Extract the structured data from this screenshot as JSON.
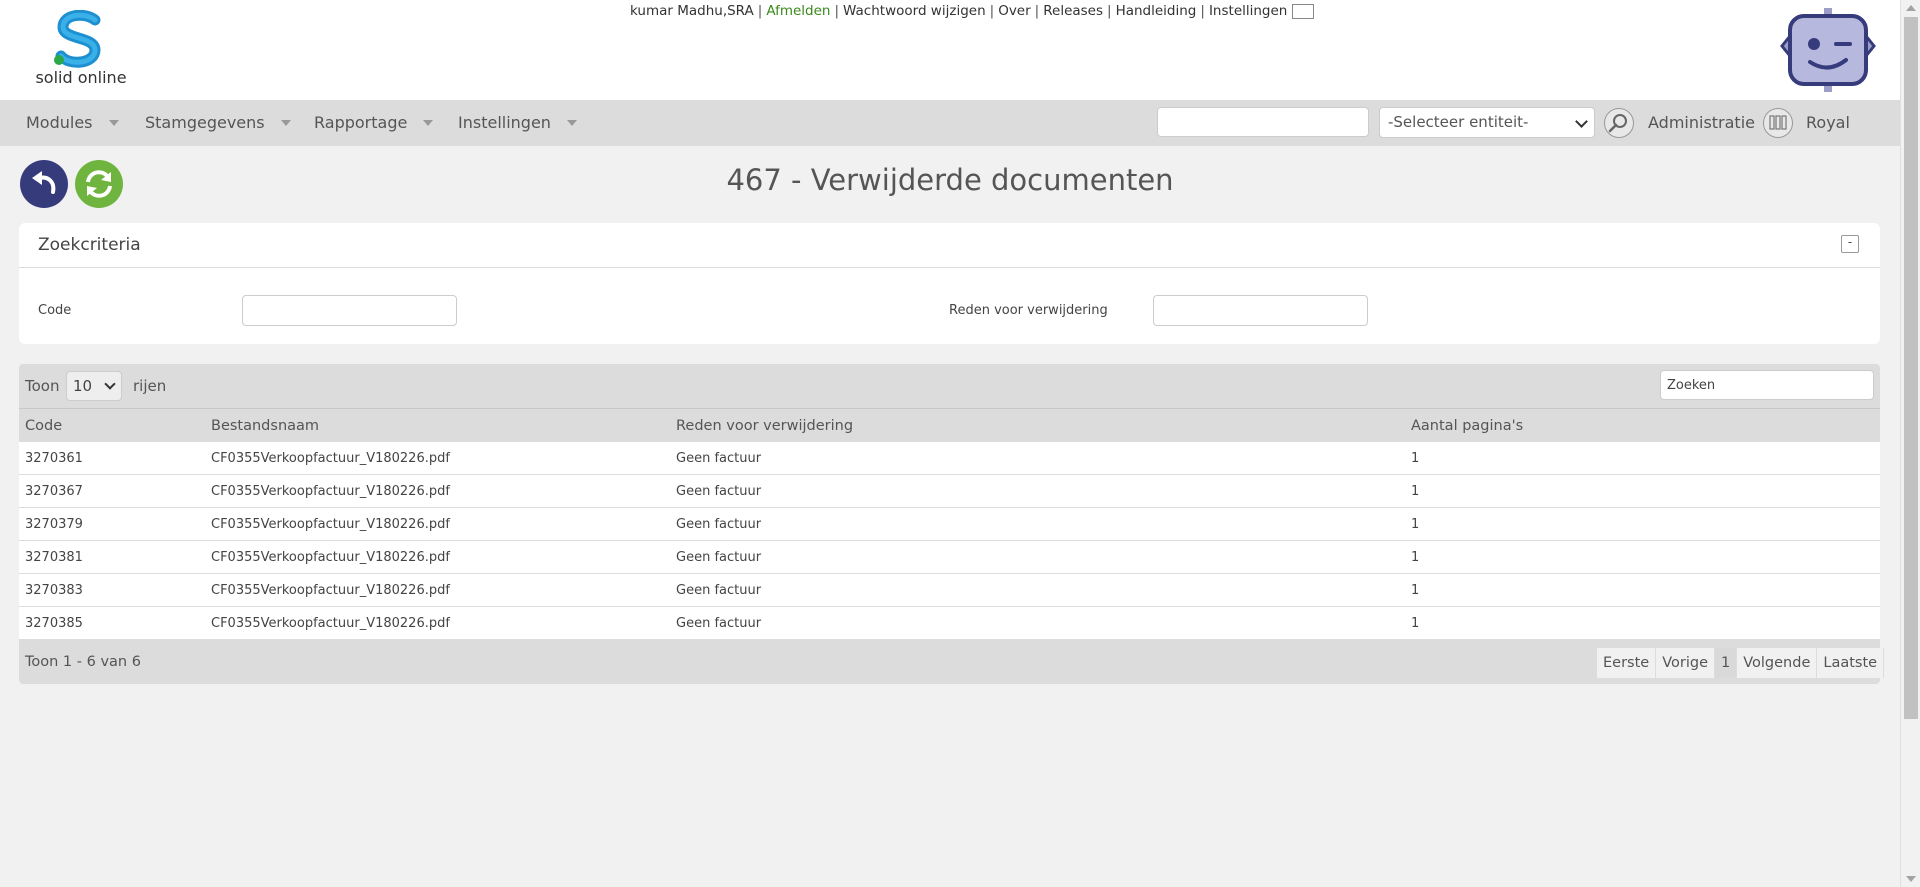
{
  "header": {
    "logo_text": "solid online",
    "user": "kumar Madhu,SRA",
    "links": {
      "logout": "Afmelden",
      "change_password": "Wachtwoord wijzigen",
      "about": "Over",
      "releases": "Releases",
      "manual": "Handleiding",
      "settings": "Instellingen"
    },
    "flag": "dutch-flag-icon"
  },
  "nav": {
    "items": [
      "Modules",
      "Stamgegevens",
      "Rapportage",
      "Instellingen"
    ],
    "search_value": "",
    "entity_select": "-Selecteer entiteit-",
    "admin_label": "Administratie",
    "company": "Royal"
  },
  "page": {
    "title": "467 - Verwijderde documenten"
  },
  "criteria": {
    "title": "Zoekcriteria",
    "collapse_symbol": "-",
    "code_label": "Code",
    "code_value": "",
    "reason_label": "Reden voor verwijdering",
    "reason_value": ""
  },
  "table": {
    "show_label": "Toon",
    "rows_per_page": "10",
    "rows_label": "rijen",
    "search_placeholder": "Zoeken",
    "columns": [
      "Code",
      "Bestandsnaam",
      "Reden voor verwijdering",
      "Aantal pagina's"
    ],
    "rows": [
      [
        "3270361",
        "CF0355Verkoopfactuur_V180226.pdf",
        "Geen factuur",
        "1"
      ],
      [
        "3270367",
        "CF0355Verkoopfactuur_V180226.pdf",
        "Geen factuur",
        "1"
      ],
      [
        "3270379",
        "CF0355Verkoopfactuur_V180226.pdf",
        "Geen factuur",
        "1"
      ],
      [
        "3270381",
        "CF0355Verkoopfactuur_V180226.pdf",
        "Geen factuur",
        "1"
      ],
      [
        "3270383",
        "CF0355Verkoopfactuur_V180226.pdf",
        "Geen factuur",
        "1"
      ],
      [
        "3270385",
        "CF0355Verkoopfactuur_V180226.pdf",
        "Geen factuur",
        "1"
      ]
    ],
    "footer_info": "Toon 1 - 6 van 6",
    "pager": {
      "first": "Eerste",
      "prev": "Vorige",
      "current": "1",
      "next": "Volgende",
      "last": "Laatste"
    }
  },
  "colors": {
    "back_button": "#363b7c",
    "refresh_button": "#6eb43f",
    "logout_link": "#3a8a1a",
    "bars": "#dcdcdc"
  }
}
